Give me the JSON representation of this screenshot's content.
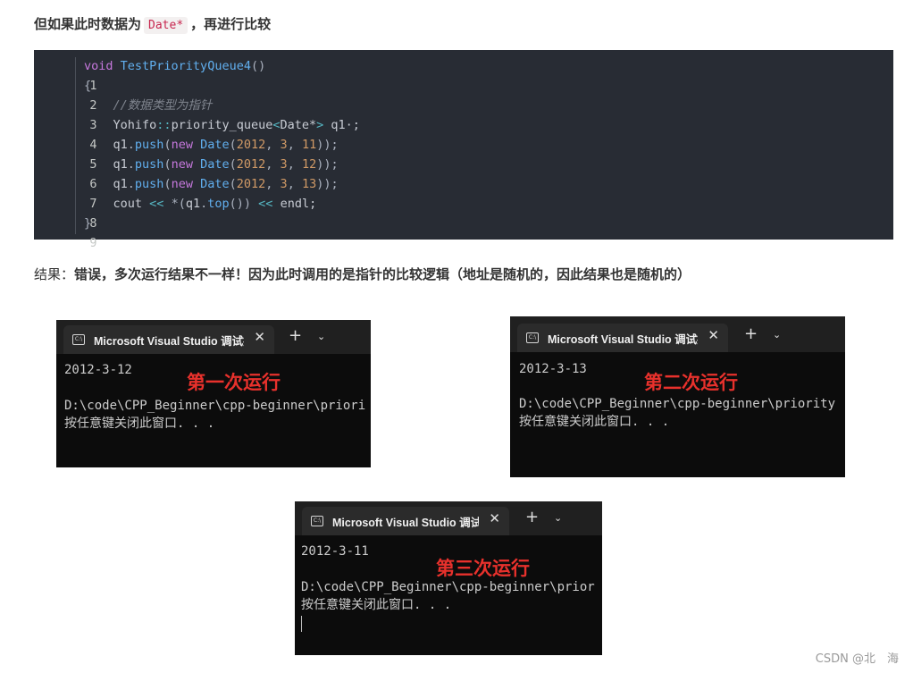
{
  "heading": {
    "prefix": "但如果此时数据为",
    "code": "Date*",
    "suffix": "，再进行比较"
  },
  "code_lines": [
    {
      "n": "1"
    },
    {
      "n": "2"
    },
    {
      "n": "3"
    },
    {
      "n": "4"
    },
    {
      "n": "5"
    },
    {
      "n": "6"
    },
    {
      "n": "7"
    },
    {
      "n": "8"
    },
    {
      "n": "9"
    }
  ],
  "code": {
    "l1_kw": "void",
    "l1_fn": "TestPriorityQueue4",
    "l1_rest": "()",
    "l2": "{",
    "l3_comment": "//数据类型为指针",
    "l4_ns": "Yohifo",
    "l4_sep": "::",
    "l4_type": "priority_queue",
    "l4_lt": "<",
    "l4_tmpl": "Date*",
    "l4_gt": ">",
    "l4_var": " q1·;",
    "push_obj": "q1",
    "push_dot": ".",
    "push_fn": "push",
    "paren_open": "(",
    "kw_new": "new",
    "ctor": "Date",
    "year": "2012",
    "comma": ", ",
    "month": "3",
    "day_11": "11",
    "day_12": "12",
    "day_13": "13",
    "close": "));",
    "l8_cout": "cout",
    "l8_op1": "<<",
    "l8_star": "*(",
    "l8_q1": "q1",
    "l8_dot": ".",
    "l8_top": "top",
    "l8_mid": "())",
    "l8_op2": "<<",
    "l8_endl": "endl;",
    "l9": "}"
  },
  "result": {
    "prefix": "结果：",
    "bold": "错误，多次运行结果不一样！因为此时调用的是指针的比较逻辑（地址是随机的，因此结果也是随机的）"
  },
  "terminal": {
    "tab_title": "Microsoft Visual Studio 调试控制台",
    "close_glyph": "✕",
    "plus_glyph": "+",
    "chevron_glyph": "⌄",
    "icon_text": "C:\\",
    "path_line_1": "D:\\code\\CPP_Beginner\\cpp-beginner\\priori",
    "path_line_2": "D:\\code\\CPP_Beginner\\cpp-beginner\\priority",
    "path_line_3": "D:\\code\\CPP_Beginner\\cpp-beginner\\prior",
    "press_key": "按任意键关闭此窗口. . ."
  },
  "runs": [
    {
      "output": "2012-3-12",
      "label": "第一次运行"
    },
    {
      "output": "2012-3-13",
      "label": "第二次运行"
    },
    {
      "output": "2012-3-11",
      "label": "第三次运行"
    }
  ],
  "watermark": "CSDN @北　海"
}
